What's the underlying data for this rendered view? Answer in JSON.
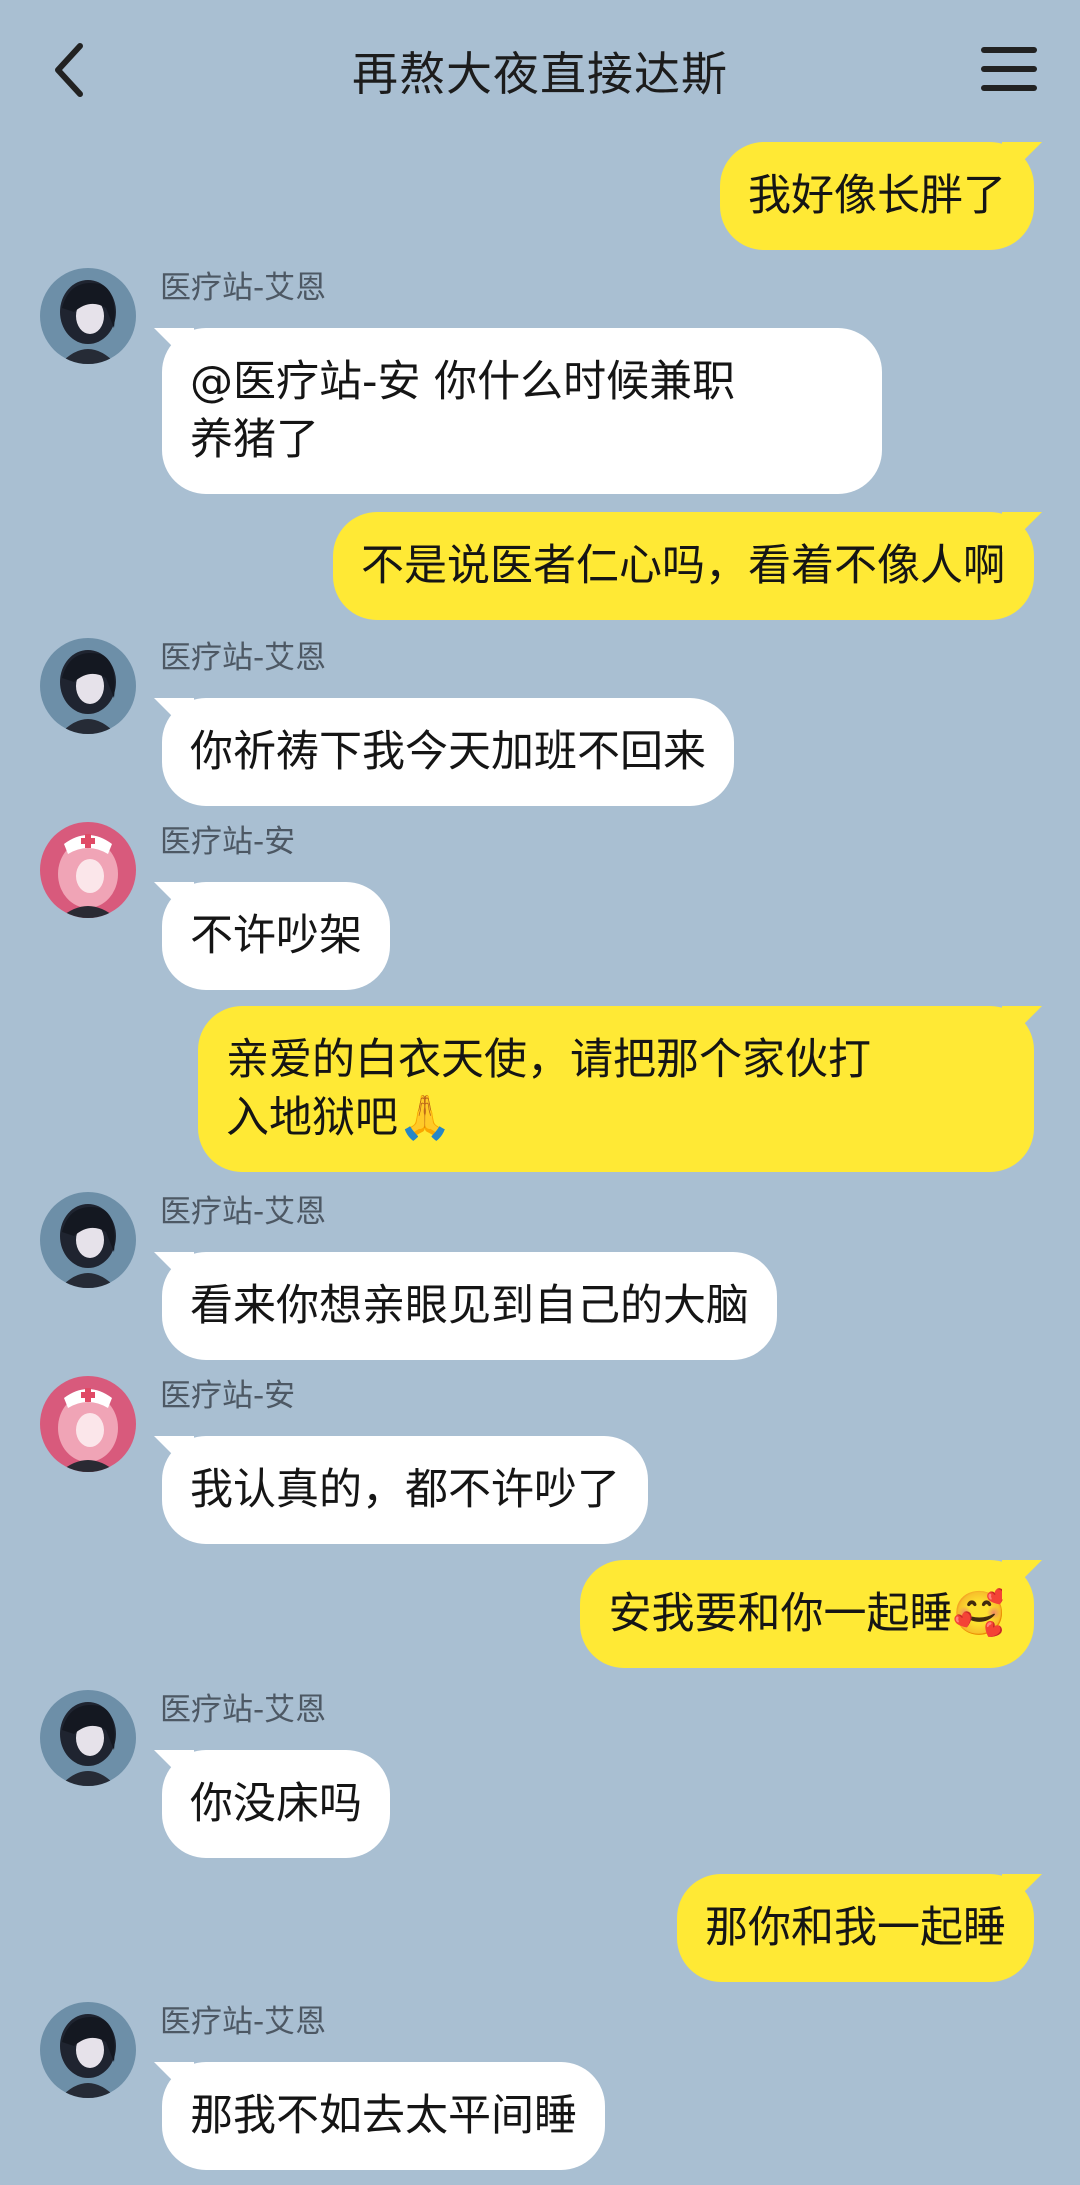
{
  "header": {
    "title": "再熬大夜直接达斯",
    "back_icon": "chevron-left-icon",
    "menu_icon": "hamburger-menu-icon"
  },
  "messages": [
    {
      "side": "out",
      "text": "我好像长胖了"
    },
    {
      "side": "in",
      "sender": "医疗站-艾恩",
      "avatar": "dark-hair-avatar",
      "text": "@医疗站-安 你什么时候兼职\n养猪了"
    },
    {
      "side": "out",
      "text": "不是说医者仁心吗，看着不像人啊"
    },
    {
      "side": "in",
      "sender": "医疗站-艾恩",
      "avatar": "dark-hair-avatar",
      "text": "你祈祷下我今天加班不回来"
    },
    {
      "side": "in",
      "sender": "医疗站-安",
      "avatar": "pink-nurse-avatar",
      "text": "不许吵架"
    },
    {
      "side": "out",
      "text": "亲爱的白衣天使，请把那个家伙打\n入地狱吧🙏"
    },
    {
      "side": "in",
      "sender": "医疗站-艾恩",
      "avatar": "dark-hair-avatar",
      "text": "看来你想亲眼见到自己的大脑"
    },
    {
      "side": "in",
      "sender": "医疗站-安",
      "avatar": "pink-nurse-avatar",
      "text": "我认真的，都不许吵了"
    },
    {
      "side": "out",
      "text": "安我要和你一起睡🥰"
    },
    {
      "side": "in",
      "sender": "医疗站-艾恩",
      "avatar": "dark-hair-avatar",
      "text": "你没床吗"
    },
    {
      "side": "out",
      "text": "那你和我一起睡"
    },
    {
      "side": "in",
      "sender": "医疗站-艾恩",
      "avatar": "dark-hair-avatar",
      "text": "那我不如去太平间睡"
    }
  ],
  "colors": {
    "background": "#a9bfd2",
    "outgoing_bubble": "#ffe935",
    "incoming_bubble": "#ffffff"
  }
}
